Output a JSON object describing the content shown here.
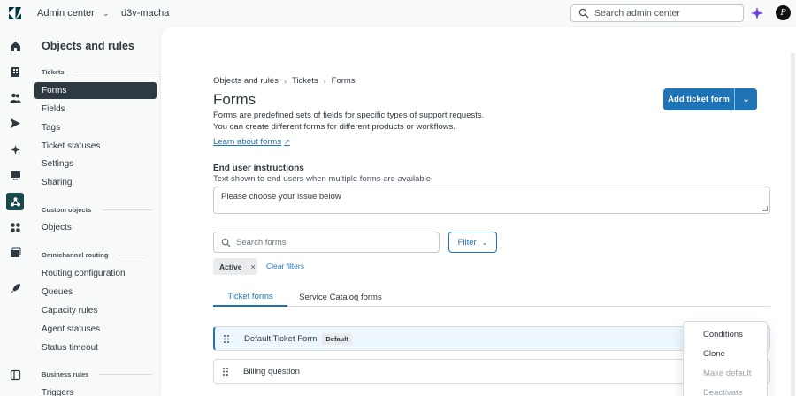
{
  "topbar": {
    "product": "Admin center",
    "subdomain": "d3v-macha",
    "search_placeholder": "Search admin center",
    "avatar_initial": "P"
  },
  "rail": {
    "items": [
      "home-icon",
      "building-icon",
      "people-icon",
      "channels-icon",
      "sparkle-ai-icon",
      "workspaces-icon",
      "objects-rules-icon",
      "apps-icon",
      "account-icon",
      "rocket-icon",
      "panel-toggle-icon"
    ],
    "active": "objects-rules-icon"
  },
  "subnav": {
    "title": "Objects and rules",
    "sections": [
      {
        "heading": "Tickets",
        "items": [
          "Forms",
          "Fields",
          "Tags",
          "Ticket statuses",
          "Settings",
          "Sharing"
        ]
      },
      {
        "heading": "Custom objects",
        "items": [
          "Objects"
        ]
      },
      {
        "heading": "Omnichannel routing",
        "items": [
          "Routing configuration",
          "Queues",
          "Capacity rules",
          "Agent statuses",
          "Status timeout"
        ]
      },
      {
        "heading": "Business rules",
        "items": [
          "Triggers"
        ]
      }
    ],
    "active_item": "Forms"
  },
  "main": {
    "breadcrumb": [
      "Objects and rules",
      "Tickets",
      "Forms"
    ],
    "title": "Forms",
    "description": "Forms are predefined sets of fields for specific types of support requests. You can create different forms for different products or workflows.",
    "learn_link": "Learn about forms",
    "add_button": "Add ticket form",
    "end_user": {
      "label": "End user instructions",
      "hint": "Text shown to end users when multiple forms are available",
      "value": "Please choose your issue below"
    },
    "search_placeholder": "Search forms",
    "filter_label": "Filter",
    "chip_label": "Active",
    "clear_filters": "Clear filters",
    "tabs": [
      "Ticket forms",
      "Service Catalog forms"
    ],
    "active_tab": "Ticket forms",
    "forms": [
      {
        "name": "Default Ticket Form",
        "badge": "Default"
      },
      {
        "name": "Billing question",
        "badge": ""
      }
    ],
    "menu": [
      "Conditions",
      "Clone",
      "Make default",
      "Deactivate"
    ],
    "menu_disabled": [
      "Make default",
      "Deactivate"
    ]
  },
  "colors": {
    "accent": "#1f73b7",
    "active_nav": "#2f3941",
    "active_rail": "#17494d"
  }
}
